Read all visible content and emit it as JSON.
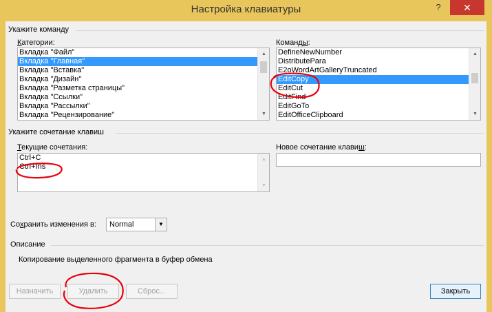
{
  "window": {
    "title": "Настройка клавиатуры",
    "help_icon": "question-mark",
    "close_icon": "close-x"
  },
  "command_group": {
    "label": "Укажите команду",
    "categories_label": "Категории:",
    "categories_label_key": "К",
    "categories_label_rest": "атегории:",
    "categories": [
      "Вкладка \"Файл\"",
      "Вкладка \"Главная\"",
      "Вкладка \"Вставка\"",
      "Вкладка \"Дизайн\"",
      "Вкладка \"Разметка страницы\"",
      "Вкладка \"Ссылки\"",
      "Вкладка \"Рассылки\"",
      "Вкладка \"Рецензирование\""
    ],
    "selected_category": 1,
    "commands_label_start": "Команд",
    "commands_label_key": "ы",
    "commands_label_end": ":",
    "commands": [
      "DefineNewNumber",
      "DistributePara",
      "E2oWordArtGalleryTruncated",
      "EditCopy",
      "EditCut",
      "EditFind",
      "EditGoTo",
      "EditOfficeClipboard"
    ],
    "selected_command": 3
  },
  "shortcut_group": {
    "label": "Укажите сочетание клавиш",
    "current_label_key": "Т",
    "current_label_rest": "екущие сочетания:",
    "current_keys": [
      "Ctrl+C",
      "Ctrl+Ins"
    ],
    "new_label_start": "Новое сочетание клави",
    "new_label_key": "ш",
    "new_label_end": ":",
    "new_value": ""
  },
  "save_in": {
    "label_start": "Со",
    "label_key": "х",
    "label_end": "ранить изменения в:",
    "value": "Normal"
  },
  "description": {
    "label": "Описание",
    "text": "Копирование выделенного фрагмента в буфер обмена"
  },
  "buttons": {
    "assign": "Назначить",
    "remove": "Удалить",
    "reset": "Сброс...",
    "close": "Закрыть"
  },
  "colors": {
    "title_bar": "#e8c65c",
    "close_button": "#c7372f",
    "selection": "#3399ff",
    "annotation": "#e8000b"
  }
}
